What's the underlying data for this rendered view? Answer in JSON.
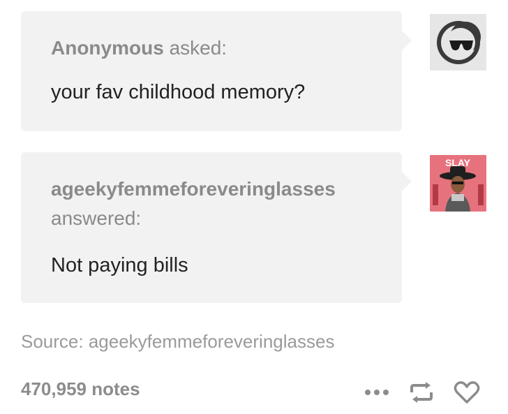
{
  "question": {
    "author": "Anonymous",
    "verb": "asked:",
    "text": "your fav childhood memory?",
    "avatar_icon": "anonymous-sunglasses-icon"
  },
  "answer": {
    "author": "ageekyfemmeforeveringlasses",
    "verb": "answered:",
    "text": "Not paying bills",
    "avatar_text": "SLAY"
  },
  "source": {
    "label": "Source: ageekyfemmeforeveringlasses"
  },
  "footer": {
    "notes": "470,959 notes",
    "icons": [
      "more-icon",
      "reblog-icon",
      "heart-icon"
    ]
  },
  "colors": {
    "bubble": "#f2f2f2",
    "meta_text": "#8a8a8a",
    "body_text": "#222222",
    "avatar_bg": "#e25a68"
  }
}
